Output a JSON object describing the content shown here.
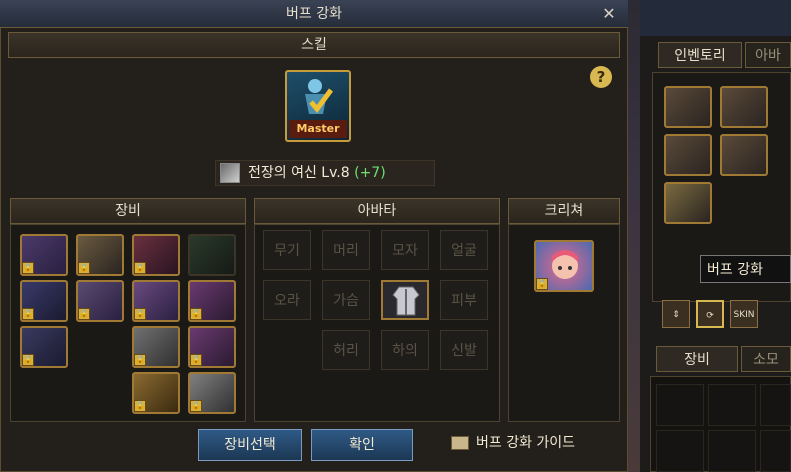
{
  "window": {
    "title": "버프 강화",
    "close_label": "✕"
  },
  "skill_section": {
    "header": "스킬",
    "badge": "Master",
    "help_label": "?",
    "skill_name": "전장의 여신 Lv.8",
    "skill_bonus": "(+7)"
  },
  "equipment": {
    "header": "장비",
    "slot_count": 14
  },
  "avatar": {
    "header": "아바타",
    "slots": [
      "무기",
      "머리",
      "모자",
      "얼굴",
      "오라",
      "가슴",
      "",
      "피부",
      "허리",
      "하의",
      "신발"
    ]
  },
  "creature": {
    "header": "크리쳐"
  },
  "buttons": {
    "select_equipment": "장비선택",
    "confirm": "확인",
    "guide": "버프 강화 가이드"
  },
  "inventory": {
    "tab_inventory": "인벤토리",
    "tab_other": "아바",
    "tooltip": "버프 강화",
    "skin_label": "SKIN",
    "tab_equipment": "장비",
    "tab_consumable": "소모"
  },
  "colors": {
    "accent_gold": "#c79b3a",
    "bonus_green": "#6fe06f",
    "button_blue": "#2f5a86"
  }
}
